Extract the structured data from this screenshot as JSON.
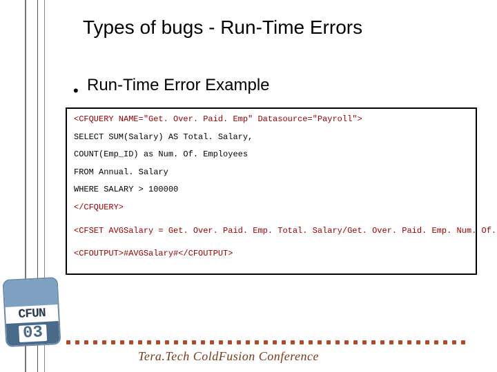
{
  "title": "Types of bugs - Run-Time Errors",
  "subtitle": "Run-Time Error Example",
  "code": {
    "l1": "<CFQUERY NAME=\"Get. Over. Paid. Emp\" Datasource=\"Payroll\">",
    "l2": "SELECT SUM(Salary) AS Total. Salary,",
    "l3": "COUNT(Emp_ID) as Num. Of. Employees",
    "l4": "FROM Annual. Salary",
    "l5": "WHERE SALARY > 100000",
    "l6": "</CFQUERY>",
    "l7": "<CFSET AVGSalary = Get. Over. Paid. Emp. Total. Salary/Get. Over. Paid. Emp. Num. Of. Employees >",
    "l8": "<CFOUTPUT>#AVGSalary#</CFOUTPUT>"
  },
  "badge": {
    "name": "CFUN",
    "year": "03"
  },
  "footer": "Tera.Tech ColdFusion Conference"
}
